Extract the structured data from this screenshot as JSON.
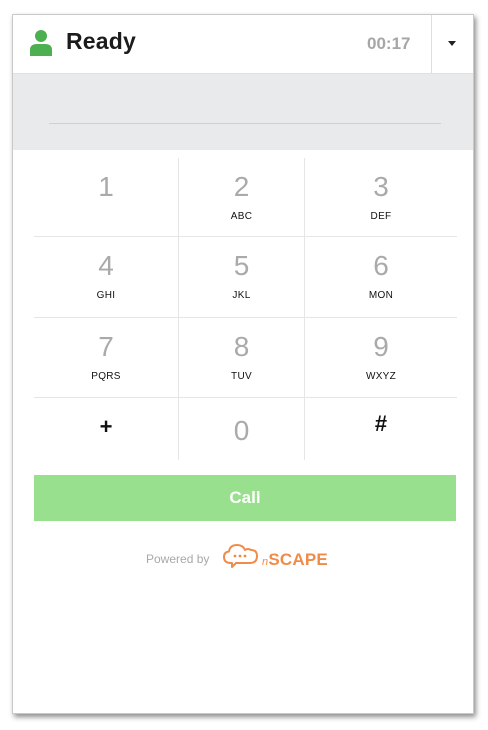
{
  "header": {
    "status_icon": "person-icon",
    "status": "Ready",
    "timer": "00:17",
    "dropdown_icon": "caret-down-icon",
    "status_color": "#4caf50"
  },
  "dialer": {
    "number_value": "",
    "keys": [
      {
        "digit": "1",
        "letters": ""
      },
      {
        "digit": "2",
        "letters": "ABC"
      },
      {
        "digit": "3",
        "letters": "DEF"
      },
      {
        "digit": "4",
        "letters": "GHI"
      },
      {
        "digit": "5",
        "letters": "JKL"
      },
      {
        "digit": "6",
        "letters": "MON"
      },
      {
        "digit": "7",
        "letters": "PQRS"
      },
      {
        "digit": "8",
        "letters": "TUV"
      },
      {
        "digit": "9",
        "letters": "WXYZ"
      },
      {
        "digit": "+",
        "letters": ""
      },
      {
        "digit": "0",
        "letters": ""
      },
      {
        "digit": "#",
        "letters": ""
      }
    ]
  },
  "call": {
    "label": "Call",
    "color": "#98e08d"
  },
  "footer": {
    "powered_by": "Powered by",
    "brand_prefix": "n",
    "brand_name": "SCAPE",
    "brand_color": "#f08c4a",
    "logo_icon": "chat-cloud-icon"
  }
}
